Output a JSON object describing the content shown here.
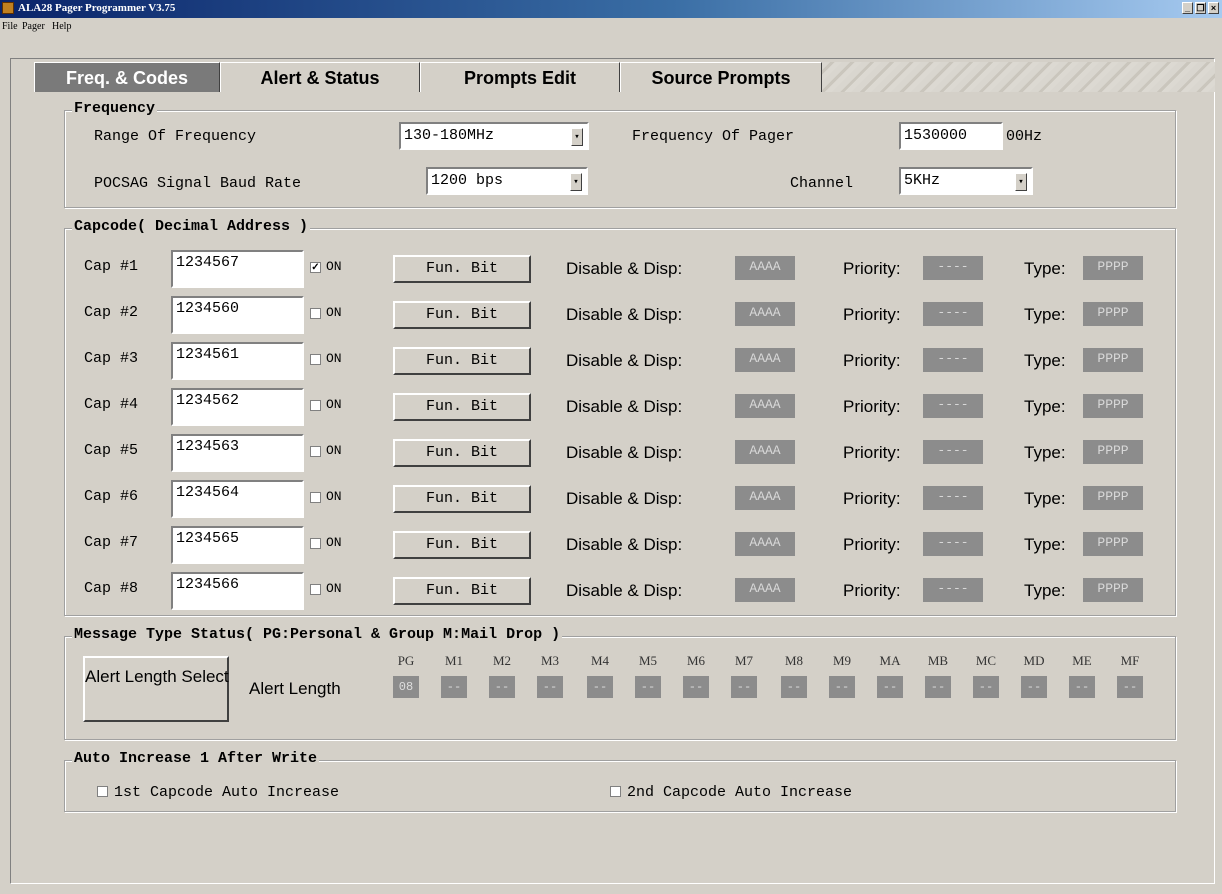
{
  "window": {
    "title": "ALA28 Pager Programmer V3.75"
  },
  "menu": [
    "File",
    "Pager",
    "Help"
  ],
  "tabs": [
    "Freq. & Codes",
    "Alert & Status",
    "Prompts Edit",
    "Source Prompts"
  ],
  "frequency": {
    "legend": "Frequency",
    "range_label": "Range Of Frequency",
    "range_value": "130-180MHz",
    "pager_freq_label": "Frequency Of Pager",
    "pager_freq_value": "1530000",
    "pager_freq_unit": "00Hz",
    "baud_label": "POCSAG Signal Baud Rate",
    "baud_value": "1200 bps",
    "channel_label": "Channel",
    "channel_value": "5KHz"
  },
  "capcode": {
    "legend": "Capcode( Decimal Address )",
    "on_label": "ON",
    "fun_bit_label": "Fun. Bit",
    "disable_label": "Disable & Disp:",
    "priority_label": "Priority:",
    "type_label": "Type:",
    "rows": [
      {
        "label": "Cap #1",
        "value": "1234567",
        "checked": true,
        "disp": "AAAA",
        "priority": "----",
        "type": "PPPP"
      },
      {
        "label": "Cap #2",
        "value": "1234560",
        "checked": false,
        "disp": "AAAA",
        "priority": "----",
        "type": "PPPP"
      },
      {
        "label": "Cap #3",
        "value": "1234561",
        "checked": false,
        "disp": "AAAA",
        "priority": "----",
        "type": "PPPP"
      },
      {
        "label": "Cap #4",
        "value": "1234562",
        "checked": false,
        "disp": "AAAA",
        "priority": "----",
        "type": "PPPP"
      },
      {
        "label": "Cap #5",
        "value": "1234563",
        "checked": false,
        "disp": "AAAA",
        "priority": "----",
        "type": "PPPP"
      },
      {
        "label": "Cap #6",
        "value": "1234564",
        "checked": false,
        "disp": "AAAA",
        "priority": "----",
        "type": "PPPP"
      },
      {
        "label": "Cap #7",
        "value": "1234565",
        "checked": false,
        "disp": "AAAA",
        "priority": "----",
        "type": "PPPP"
      },
      {
        "label": "Cap #8",
        "value": "1234566",
        "checked": false,
        "disp": "AAAA",
        "priority": "----",
        "type": "PPPP"
      }
    ]
  },
  "message_type": {
    "legend": "Message Type Status( PG:Personal & Group     M:Mail Drop )",
    "button_label": "Alert Length Select",
    "alert_length_label": "Alert Length",
    "headers": [
      "PG",
      "M1",
      "M2",
      "M3",
      "M4",
      "M5",
      "M6",
      "M7",
      "M8",
      "M9",
      "MA",
      "MB",
      "MC",
      "MD",
      "ME",
      "MF"
    ],
    "values": [
      "08",
      "--",
      "--",
      "--",
      "--",
      "--",
      "--",
      "--",
      "--",
      "--",
      "--",
      "--",
      "--",
      "--",
      "--",
      "--"
    ]
  },
  "auto_increase": {
    "legend": "Auto Increase 1 After Write",
    "first_label": "1st Capcode Auto Increase",
    "second_label": "2nd Capcode Auto Increase"
  },
  "window_buttons": {
    "minimize": "_",
    "maximize": "❐",
    "close": "×"
  }
}
